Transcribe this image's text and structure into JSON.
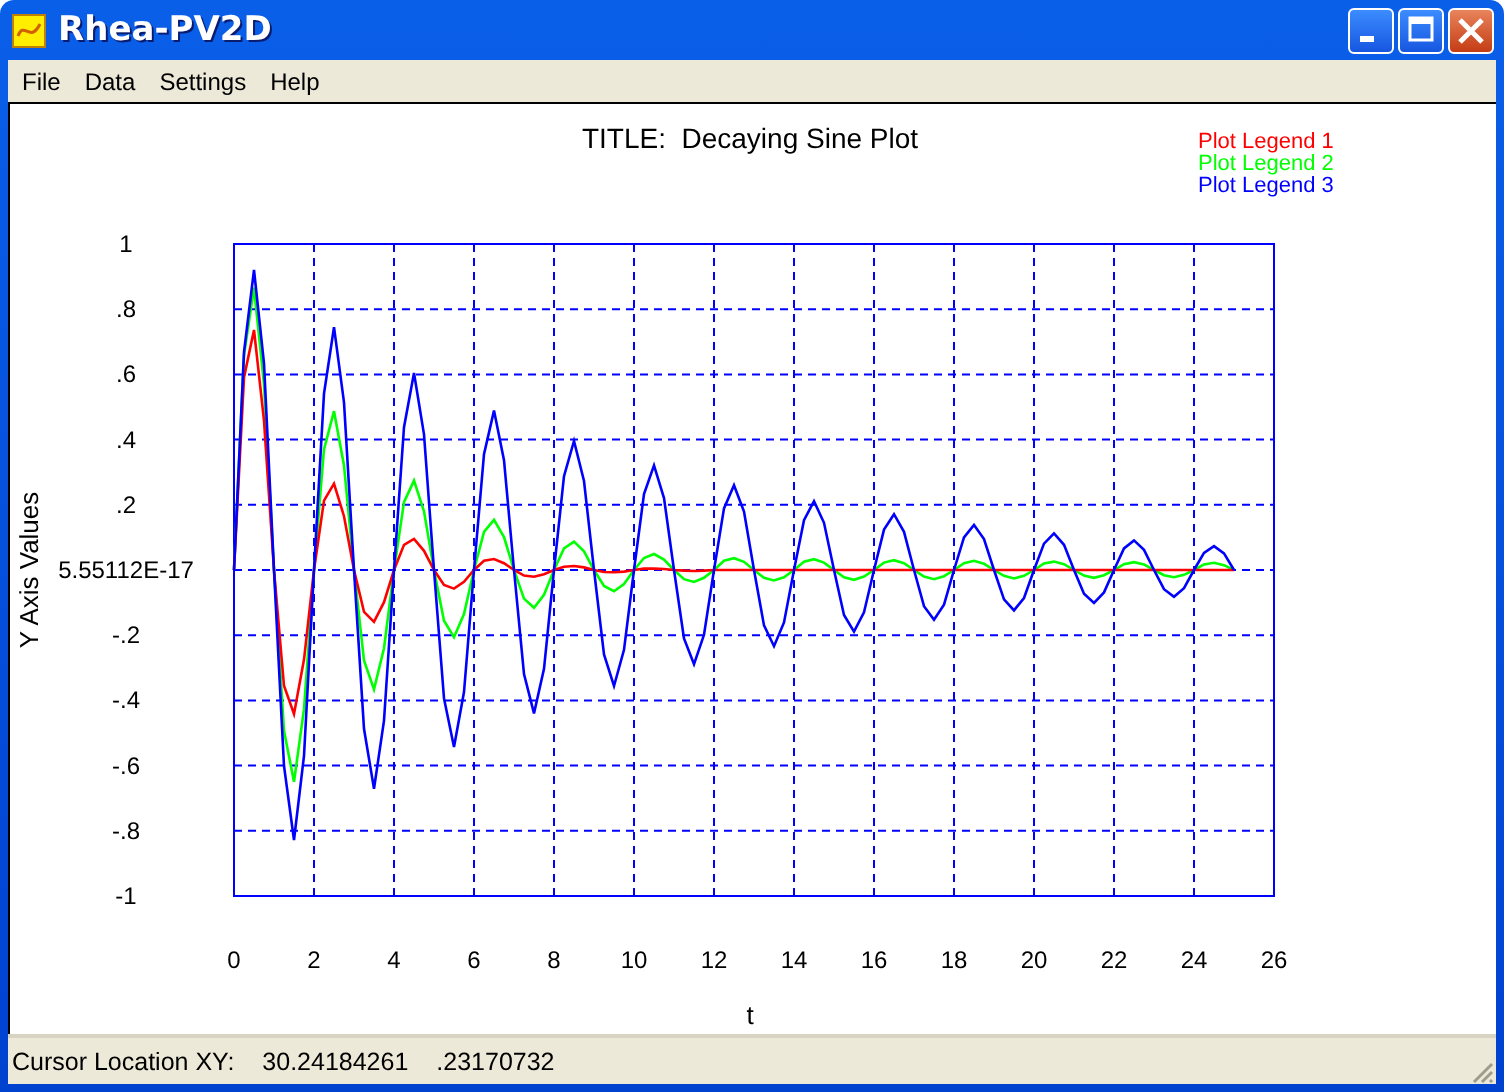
{
  "window": {
    "title": "Rhea-PV2D"
  },
  "menu": [
    "File",
    "Data",
    "Settings",
    "Help"
  ],
  "plot": {
    "chart_data": {
      "type": "line",
      "title": "TITLE:  Decaying Sine Plot",
      "xlabel": "t",
      "ylabel": "Y Axis Values",
      "x": [
        0,
        0.25,
        0.5,
        0.75,
        1,
        1.25,
        1.5,
        1.75,
        2,
        2.25,
        2.5,
        2.75,
        3,
        3.25,
        3.5,
        3.75,
        4,
        4.25,
        4.5,
        4.75,
        5,
        5.25,
        5.5,
        5.75,
        6,
        6.25,
        6.5,
        6.75,
        7,
        7.25,
        7.5,
        7.75,
        8,
        8.25,
        8.5,
        8.75,
        9,
        9.25,
        9.5,
        9.75,
        10,
        10.25,
        10.5,
        10.75,
        11,
        11.25,
        11.5,
        11.75,
        12,
        12.25,
        12.5,
        12.75,
        13,
        13.25,
        13.5,
        13.75,
        14,
        14.25,
        14.5,
        14.75,
        15,
        15.25,
        15.5,
        15.75,
        16,
        16.25,
        16.5,
        16.75,
        17,
        17.25,
        17.5,
        17.75,
        18,
        18.25,
        18.5,
        18.75,
        19,
        19.25,
        19.5,
        19.75,
        20,
        20.25,
        20.5,
        20.75,
        21,
        21.25,
        21.5,
        21.75,
        22,
        22.25,
        22.5,
        22.75,
        23,
        23.25,
        23.5,
        23.75,
        24,
        24.25,
        24.5,
        24.75,
        25
      ],
      "series": [
        {
          "name": "Plot Legend 1",
          "color": "#ff0000",
          "values": [
            0,
            0.591,
            0.736,
            0.458,
            0,
            -0.355,
            -0.442,
            -0.275,
            0,
            0.213,
            0.265,
            0.165,
            0,
            -0.128,
            -0.159,
            -0.099,
            0,
            0.077,
            0.095,
            0.059,
            0,
            -0.046,
            -0.057,
            -0.036,
            0,
            0.028,
            0.034,
            0.021,
            0,
            -0.017,
            -0.021,
            -0.013,
            0,
            0.01,
            0.012,
            0.008,
            0,
            -0.006,
            -0.007,
            -0.005,
            0,
            0.004,
            0.004,
            0.003,
            0,
            -0.002,
            -0.003,
            -0.002,
            0,
            0,
            0,
            0,
            0,
            0,
            0,
            0,
            0,
            0,
            0,
            0,
            0,
            0,
            0,
            0,
            0,
            0,
            0,
            0,
            0,
            0,
            0,
            0,
            0,
            0,
            0,
            0,
            0,
            0,
            0,
            0,
            0,
            0,
            0,
            0,
            0,
            0,
            0,
            0,
            0,
            0,
            0,
            0,
            0,
            0,
            0,
            0,
            0,
            0,
            0,
            0,
            0
          ]
        },
        {
          "name": "Plot Legend 2",
          "color": "#00ff00",
          "values": [
            0,
            0.658,
            0.866,
            0.57,
            0,
            -0.493,
            -0.65,
            -0.427,
            0,
            0.37,
            0.487,
            0.321,
            0,
            -0.277,
            -0.366,
            -0.24,
            0,
            0.208,
            0.274,
            0.18,
            0,
            -0.156,
            -0.206,
            -0.135,
            0,
            0.117,
            0.154,
            0.101,
            0,
            -0.088,
            -0.116,
            -0.076,
            0,
            0.066,
            0.087,
            0.057,
            0,
            -0.049,
            -0.065,
            -0.043,
            0,
            0.037,
            0.049,
            0.032,
            0,
            -0.028,
            -0.037,
            -0.024,
            0,
            0.028,
            0.036,
            0.025,
            0,
            -0.024,
            -0.032,
            -0.022,
            0,
            0.025,
            0.033,
            0.023,
            0,
            -0.022,
            -0.03,
            -0.02,
            0,
            0.023,
            0.03,
            0.021,
            0,
            -0.02,
            -0.028,
            -0.019,
            0,
            0.021,
            0.028,
            0.019,
            0,
            -0.018,
            -0.026,
            -0.018,
            0,
            0.02,
            0.026,
            0.018,
            0,
            -0.017,
            -0.024,
            -0.016,
            0,
            0.018,
            0.024,
            0.017,
            0,
            -0.016,
            -0.022,
            -0.015,
            0,
            0.017,
            0.022,
            0.015,
            0
          ]
        },
        {
          "name": "Plot Legend 3",
          "color": "#0000ff",
          "values": [
            0,
            0.668,
            0.92,
            0.634,
            0,
            -0.601,
            -0.828,
            -0.57,
            0,
            0.541,
            0.745,
            0.514,
            0,
            -0.487,
            -0.671,
            -0.462,
            0,
            0.438,
            0.604,
            0.416,
            0,
            -0.394,
            -0.543,
            -0.374,
            0,
            0.355,
            0.489,
            0.337,
            0,
            -0.319,
            -0.44,
            -0.303,
            0,
            0.288,
            0.396,
            0.273,
            0,
            -0.259,
            -0.356,
            -0.245,
            0,
            0.233,
            0.321,
            0.221,
            0,
            -0.21,
            -0.289,
            -0.199,
            0,
            0.189,
            0.26,
            0.179,
            0,
            -0.17,
            -0.234,
            -0.161,
            0,
            0.153,
            0.211,
            0.145,
            0,
            -0.138,
            -0.189,
            -0.13,
            0,
            0.124,
            0.171,
            0.117,
            0,
            -0.111,
            -0.153,
            -0.106,
            0,
            0.1,
            0.138,
            0.095,
            0,
            -0.09,
            -0.124,
            -0.086,
            0,
            0.081,
            0.112,
            0.077,
            0,
            -0.073,
            -0.101,
            -0.069,
            0,
            0.066,
            0.091,
            0.062,
            0,
            -0.059,
            -0.082,
            -0.056,
            0,
            0.053,
            0.073,
            0.051,
            0
          ]
        }
      ],
      "grid": true,
      "xlim": [
        0,
        26
      ],
      "ylim": [
        -1,
        1
      ],
      "xticks": [
        0,
        2,
        4,
        6,
        8,
        10,
        12,
        14,
        16,
        18,
        20,
        22,
        24,
        26
      ],
      "yticks": [
        {
          "value": 1,
          "label": "1"
        },
        {
          "value": 0.8,
          "label": ".8"
        },
        {
          "value": 0.6,
          "label": ".6"
        },
        {
          "value": 0.4,
          "label": ".4"
        },
        {
          "value": 0.2,
          "label": ".2"
        },
        {
          "value": 0,
          "label": "5.55112E-17"
        },
        {
          "value": -0.2,
          "label": "-.2"
        },
        {
          "value": -0.4,
          "label": "-.4"
        },
        {
          "value": -0.6,
          "label": "-.6"
        },
        {
          "value": -0.8,
          "label": "-.8"
        },
        {
          "value": -1,
          "label": "-1"
        }
      ]
    }
  },
  "status_bar": {
    "label": "Cursor Location XY:",
    "x_value": "30.24184261",
    "y_value": ".23170732"
  }
}
